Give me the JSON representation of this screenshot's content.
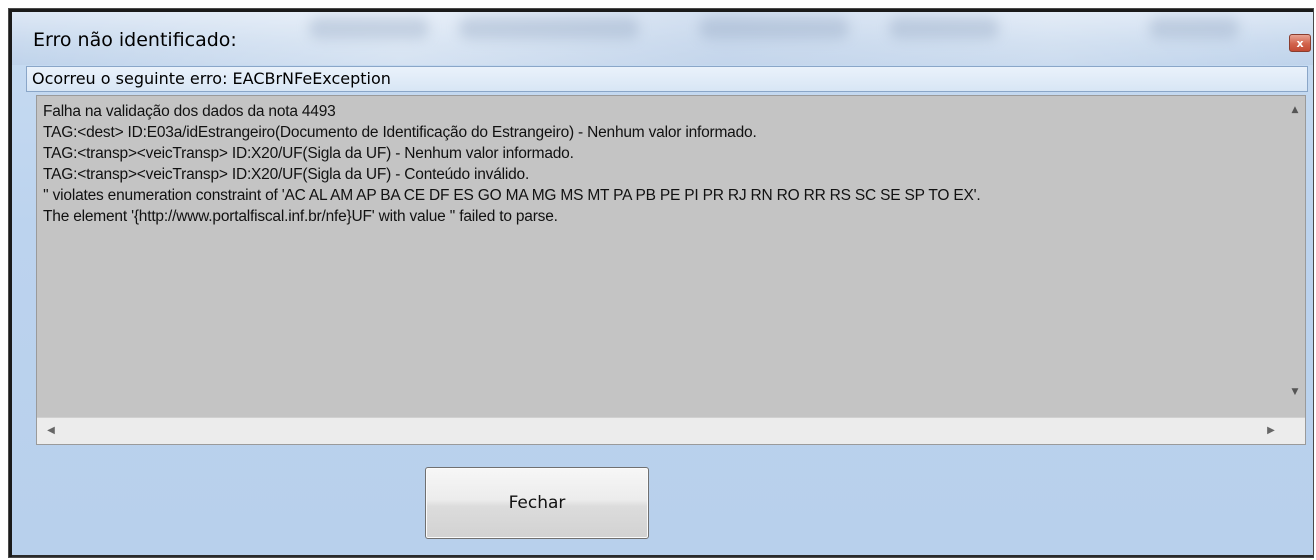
{
  "window": {
    "title": "Erro não identificado:",
    "close_icon": "close-icon",
    "close_glyph": "x"
  },
  "header": {
    "message": "Ocorreu o seguinte erro: EACBrNFeException"
  },
  "memo": {
    "lines": [
      "Falha na validação dos dados da nota 4493",
      "TAG:<dest> ID:E03a/idEstrangeiro(Documento de Identificação do Estrangeiro) - Nenhum valor informado.",
      "TAG:<transp><veicTransp> ID:X20/UF(Sigla da UF) - Nenhum valor informado.",
      "TAG:<transp><veicTransp> ID:X20/UF(Sigla da UF) - Conteúdo inválido.",
      "'' violates enumeration constraint of 'AC AL AM AP BA CE DF ES GO MA MG MS MT PA PB PE PI PR RJ RN RO RR RS SC SE SP TO EX'.",
      "The element '{http://www.portalfiscal.inf.br/nfe}UF' with value '' failed to parse."
    ]
  },
  "scrollbars": {
    "up_arrow": "▲",
    "down_arrow": "▼",
    "left_arrow": "◀",
    "right_arrow": "▶"
  },
  "buttons": {
    "close_label": "Fechar"
  },
  "colors": {
    "window_bg": "#bcd3ee",
    "memo_bg": "#c4c4c4",
    "close_button": "#d2634c"
  }
}
